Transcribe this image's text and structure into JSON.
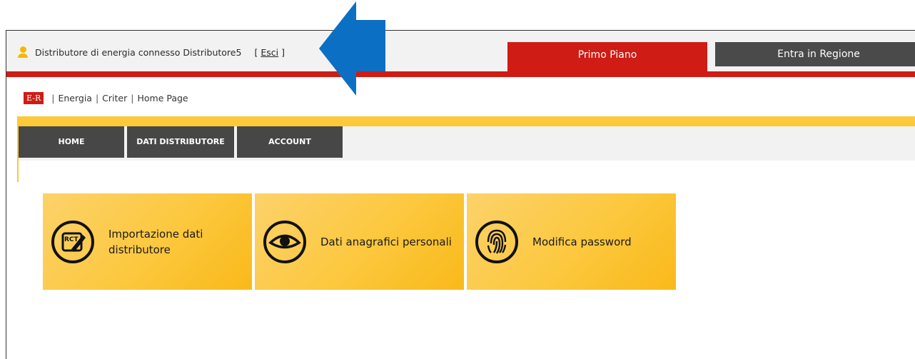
{
  "header": {
    "user_text": "Distributore di energia connesso Distributore5",
    "logout_open": "[",
    "logout_label": "Esci",
    "logout_close": "]",
    "tab_primo_piano": "Primo Piano",
    "tab_entra_regione": "Entra in Regione"
  },
  "breadcrumb": {
    "logo": "E-R",
    "items": [
      "Energia",
      "Criter",
      "Home Page"
    ]
  },
  "menu": {
    "items": [
      "HOME",
      "DATI DISTRIBUTORE",
      "ACCOUNT"
    ]
  },
  "tiles": [
    {
      "label_line1": "Importazione dati",
      "label_line2": "distributore",
      "icon": "rct-edit-icon",
      "icon_text": "RCT"
    },
    {
      "label_line1": "Dati anagrafici personali",
      "label_line2": "",
      "icon": "eye-icon"
    },
    {
      "label_line1": "Modifica password",
      "label_line2": "",
      "icon": "fingerprint-icon"
    }
  ],
  "colors": {
    "red": "#cf1c14",
    "yellow": "#fcc93b",
    "dark_gray": "#474747",
    "arrow_blue": "#0b6fc4"
  }
}
